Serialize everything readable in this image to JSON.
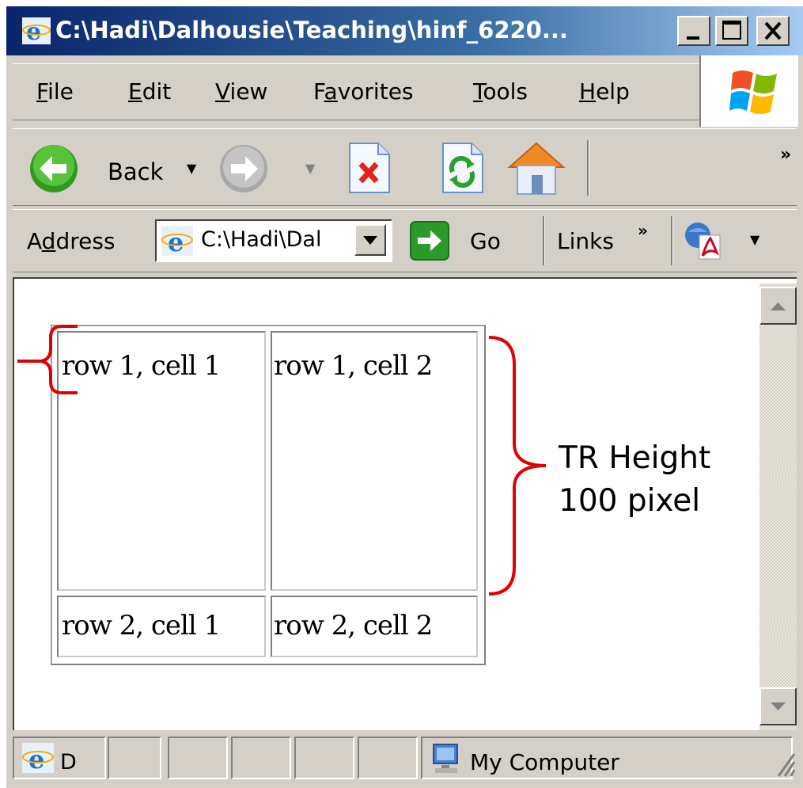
{
  "window": {
    "title": "C:\\Hadi\\Dalhousie\\Teaching\\hinf_6220...",
    "controls": {
      "minimize": "_",
      "maximize": "□",
      "close": "X"
    }
  },
  "menubar": {
    "items": [
      {
        "label": "File",
        "accel": "F",
        "rest": "ile"
      },
      {
        "label": "Edit",
        "accel": "E",
        "rest": "dit"
      },
      {
        "label": "View",
        "accel": "V",
        "rest": "iew"
      },
      {
        "label": "Favorites",
        "pre": "F",
        "accel": "a",
        "rest": "vorites"
      },
      {
        "label": "Tools",
        "accel": "T",
        "rest": "ools"
      },
      {
        "label": "Help",
        "accel": "H",
        "rest": "elp"
      }
    ]
  },
  "toolbar": {
    "back_label": "Back",
    "overflow": "»",
    "icons": [
      "back-icon",
      "forward-icon",
      "stop-icon",
      "refresh-icon",
      "home-icon"
    ]
  },
  "addressbar": {
    "label_pre": "A",
    "label_accel": "d",
    "label_rest": "dress",
    "value": "C:\\Hadi\\Dal",
    "go_label": "Go",
    "links_label": "Links",
    "links_overflow": "»"
  },
  "page": {
    "table": {
      "rows": [
        {
          "cells": [
            "row 1, cell 1",
            "row 1, cell 2"
          ]
        },
        {
          "cells": [
            "row 2, cell 1",
            "row 2, cell 2"
          ]
        }
      ]
    },
    "annotation": {
      "line1": "TR Height",
      "line2": "100 pixel",
      "color": "#e00000"
    }
  },
  "statusbar": {
    "left_text": "D",
    "zone": "My Computer"
  },
  "colors": {
    "titlebar_start": "#0a246a",
    "titlebar_end": "#a6caf0",
    "chrome": "#d4d0c8",
    "bracket": "#e00000"
  }
}
